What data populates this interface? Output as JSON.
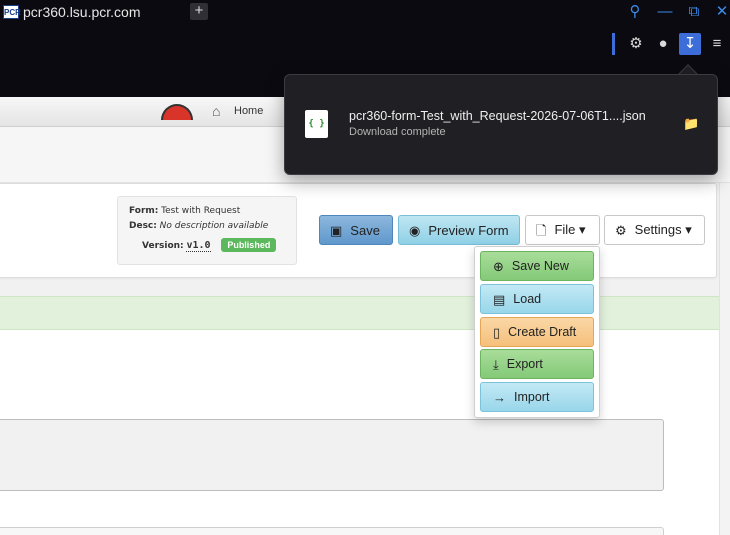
{
  "browser": {
    "favicon_text": "PCR",
    "tab_title": "pcr360.lsu.pcr.com",
    "new_tab_icon": "+",
    "accent": "#3b8be8"
  },
  "download": {
    "filename": "pcr360-form-Test_with_Request-2026-07-06T1....json",
    "status": "Download complete",
    "file_icon_glyph": "{ }"
  },
  "navbar": {
    "home_label": "Home"
  },
  "form_info": {
    "form_label": "Form:",
    "form_value": "Test with Request",
    "desc_label": "Desc:",
    "desc_value": "No description available",
    "version_label": "Version:",
    "version_value": "v1.0",
    "status_badge": "Published"
  },
  "toolbar": {
    "save_label": "Save",
    "preview_label": "Preview Form",
    "file_label": "File ▾",
    "settings_label": "Settings ▾"
  },
  "file_menu": {
    "items": [
      {
        "label": "Save New",
        "icon": "plus-circle-icon"
      },
      {
        "label": "Load",
        "icon": "books-icon"
      },
      {
        "label": "Create Draft",
        "icon": "file-icon"
      },
      {
        "label": "Export",
        "icon": "download-icon"
      },
      {
        "label": "Import",
        "icon": "arrow-right-icon"
      }
    ]
  }
}
